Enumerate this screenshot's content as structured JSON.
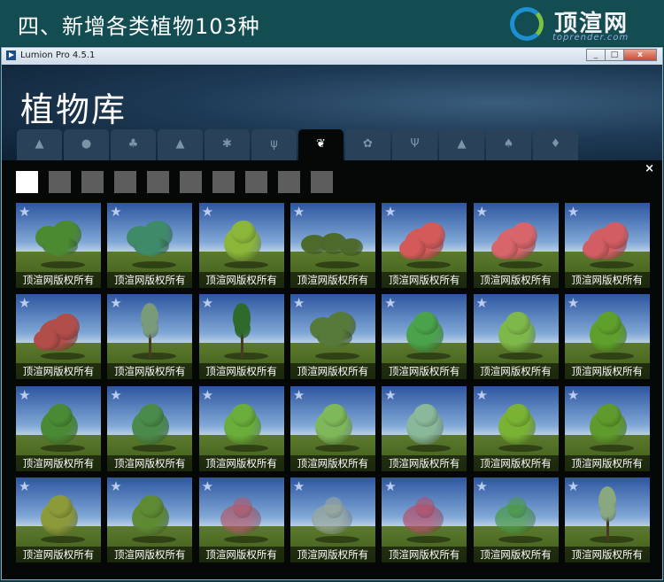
{
  "banner": {
    "title": "四、新增各类植物103种",
    "logo_text": "顶渲网",
    "logo_sub": "toprender.com"
  },
  "window": {
    "title": "Lumion Pro 4.5.1",
    "btn_min": "_",
    "btn_max": "□",
    "btn_close": "x"
  },
  "header": {
    "title": "植物库"
  },
  "tabs": [
    {
      "icon": "small-tree-icon",
      "glyph": "▲"
    },
    {
      "icon": "round-tree-icon",
      "glyph": "●"
    },
    {
      "icon": "broad-tree-icon",
      "glyph": "♣"
    },
    {
      "icon": "conifer-icon",
      "glyph": "▲"
    },
    {
      "icon": "palm-icon",
      "glyph": "✱"
    },
    {
      "icon": "grass-icon",
      "glyph": "ψ"
    },
    {
      "icon": "plant-leaves-icon",
      "glyph": "❦",
      "active": true
    },
    {
      "icon": "flower-icon",
      "glyph": "✿"
    },
    {
      "icon": "cactus-icon",
      "glyph": "Ψ"
    },
    {
      "icon": "rock-icon",
      "glyph": "▲"
    },
    {
      "icon": "forest-icon",
      "glyph": "♠"
    },
    {
      "icon": "leaf-icon",
      "glyph": "♦"
    }
  ],
  "close_label": "×",
  "pages": {
    "count": 10,
    "active": 0
  },
  "caption": "顶渲网版权所有",
  "star_glyph": "★",
  "tiles": [
    {
      "type": "fan",
      "color": "#4c8a32"
    },
    {
      "type": "fan",
      "color": "#3f8a68"
    },
    {
      "type": "bush",
      "color": "#8ab63a"
    },
    {
      "type": "low",
      "color": "#4d6a2a"
    },
    {
      "type": "flower",
      "color": "#d45a5a"
    },
    {
      "type": "flower",
      "color": "#d8656a"
    },
    {
      "type": "flower",
      "color": "#d25d62"
    },
    {
      "type": "flower",
      "color": "#b24e4a"
    },
    {
      "type": "tall",
      "color": "#7a9b7a"
    },
    {
      "type": "tall",
      "color": "#2f6a2a"
    },
    {
      "type": "fan",
      "color": "#567a3a"
    },
    {
      "type": "bush",
      "color": "#4aa34a"
    },
    {
      "type": "bush",
      "color": "#7fb84a"
    },
    {
      "type": "bush",
      "color": "#5fa02c"
    },
    {
      "type": "bush",
      "color": "#4a8a34"
    },
    {
      "type": "bush",
      "color": "#4a8a4a"
    },
    {
      "type": "bush",
      "color": "#6aad3a"
    },
    {
      "type": "bush",
      "color": "#7fb85a"
    },
    {
      "type": "bush",
      "color": "#8ab89a"
    },
    {
      "type": "bush",
      "color": "#7ab234"
    },
    {
      "type": "bush",
      "color": "#5f9a2c"
    },
    {
      "type": "bush",
      "color": "#8c9a3a"
    },
    {
      "type": "bush",
      "color": "#5f8a34"
    },
    {
      "type": "sparse",
      "color": "#b05a6a"
    },
    {
      "type": "sparse",
      "color": "#9aa89a"
    },
    {
      "type": "sparse",
      "color": "#b4506a"
    },
    {
      "type": "sparse",
      "color": "#4a9a44"
    },
    {
      "type": "tall",
      "color": "#8aa880"
    }
  ],
  "colors": {
    "active_tab": "#060707",
    "inactive_tab": "#2a4259",
    "page_active": "#ffffff",
    "page_inactive": "#5d5d5d"
  }
}
